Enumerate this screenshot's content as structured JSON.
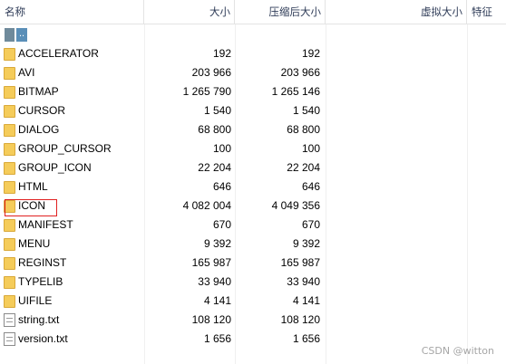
{
  "columns": {
    "name": "名称",
    "size": "大小",
    "compressed": "压缩后大小",
    "virtual": "虚拟大小",
    "attributes": "特征"
  },
  "up_label": "..",
  "rows": [
    {
      "name": "ACCELERATOR",
      "size": "192",
      "compressed": "192",
      "type": "folder"
    },
    {
      "name": "AVI",
      "size": "203 966",
      "compressed": "203 966",
      "type": "folder"
    },
    {
      "name": "BITMAP",
      "size": "1 265 790",
      "compressed": "1 265 146",
      "type": "folder"
    },
    {
      "name": "CURSOR",
      "size": "1 540",
      "compressed": "1 540",
      "type": "folder"
    },
    {
      "name": "DIALOG",
      "size": "68 800",
      "compressed": "68 800",
      "type": "folder"
    },
    {
      "name": "GROUP_CURSOR",
      "size": "100",
      "compressed": "100",
      "type": "folder"
    },
    {
      "name": "GROUP_ICON",
      "size": "22 204",
      "compressed": "22 204",
      "type": "folder"
    },
    {
      "name": "HTML",
      "size": "646",
      "compressed": "646",
      "type": "folder"
    },
    {
      "name": "ICON",
      "size": "4 082 004",
      "compressed": "4 049 356",
      "type": "folder"
    },
    {
      "name": "MANIFEST",
      "size": "670",
      "compressed": "670",
      "type": "folder"
    },
    {
      "name": "MENU",
      "size": "9 392",
      "compressed": "9 392",
      "type": "folder"
    },
    {
      "name": "REGINST",
      "size": "165 987",
      "compressed": "165 987",
      "type": "folder"
    },
    {
      "name": "TYPELIB",
      "size": "33 940",
      "compressed": "33 940",
      "type": "folder"
    },
    {
      "name": "UIFILE",
      "size": "4 141",
      "compressed": "4 141",
      "type": "folder"
    },
    {
      "name": "string.txt",
      "size": "108 120",
      "compressed": "108 120",
      "type": "file"
    },
    {
      "name": "version.txt",
      "size": "1 656",
      "compressed": "1 656",
      "type": "file"
    }
  ],
  "watermark": "CSDN @witton",
  "colors": {
    "folder": "#f5cc5a",
    "highlight": "#e02020",
    "header_text": "#2e3b57"
  }
}
